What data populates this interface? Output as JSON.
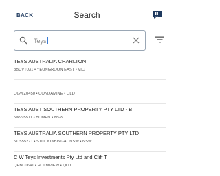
{
  "header": {
    "back_label": "BACK",
    "title": "Search"
  },
  "search": {
    "value": "Teys"
  },
  "results": [
    {
      "name": "TEYS AUSTRALIA CHARLTON",
      "sub": "3BUVT031 • YEUNGROON EAST • VIC"
    },
    {
      "name": "",
      "sub": "QGWZ0450 • CONDAMINE • QLD"
    },
    {
      "name": "TEYS AUST SOUTHERN PROPERTY PTY LTD -  B",
      "sub": "NK995511 • BOMEN • NSW"
    },
    {
      "name": "TEYS AUSTRALIA SOUTHERN PROPERTY PTY LTD",
      "sub": "NC555271 • STOCKINBINGAL NSW • NSW"
    },
    {
      "name": "C W Teys Investments Pty Ltd and Cliff T",
      "sub": "QEBC0641 • HOLMVIEW • QLD"
    }
  ],
  "icons": {
    "chat": "chat-bubble-icon",
    "search": "search-icon",
    "clear": "close-icon",
    "filter": "filter-icon"
  },
  "colors": {
    "accent": "#1f3a5f",
    "caret": "#3b7bd4"
  }
}
